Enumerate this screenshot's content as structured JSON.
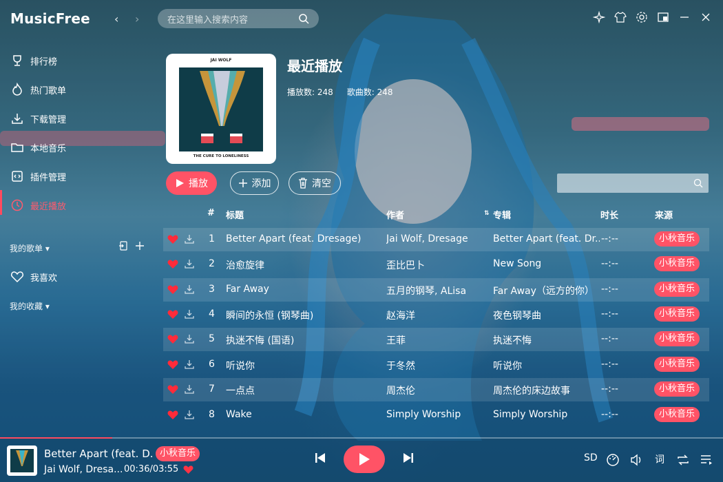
{
  "app": {
    "title": "MusicFree",
    "search_placeholder": "在这里输入搜索内容"
  },
  "titlebar": {
    "icons": [
      "sparkle-icon",
      "shirt-icon",
      "gear-icon",
      "minimode-icon",
      "minimize-icon",
      "close-icon"
    ]
  },
  "sidebar": {
    "items": [
      {
        "label": "排行榜",
        "icon": "trophy-icon"
      },
      {
        "label": "热门歌单",
        "icon": "fire-icon"
      },
      {
        "label": "下载管理",
        "icon": "download-icon"
      },
      {
        "label": "本地音乐",
        "icon": "folder-icon"
      },
      {
        "label": "插件管理",
        "icon": "plugin-icon"
      },
      {
        "label": "最近播放",
        "icon": "clock-icon",
        "active": true
      }
    ],
    "my_playlists_label": "我的歌单 ▾",
    "favorite_label": "我喜欢",
    "my_collection_label": "我的收藏 ▾"
  },
  "playlist": {
    "title": "最近播放",
    "play_count": "播放数: 248",
    "song_count": "歌曲数: 248",
    "cover_artist": "JAI WOLF",
    "cover_album": "THE CURE TO LONELINESS",
    "buttons": {
      "play": "播放",
      "add": "添加",
      "clear": "清空"
    }
  },
  "table": {
    "headers": {
      "index": "#",
      "title": "标题",
      "artist": "作者",
      "album": "专辑",
      "duration": "时长",
      "source": "来源"
    },
    "rows": [
      {
        "index": "1",
        "title": "Better Apart (feat. Dresage)",
        "artist": "Jai Wolf, Dresage",
        "album": "Better Apart (feat. Dr...",
        "duration": "--:--",
        "source": "小秋音乐"
      },
      {
        "index": "2",
        "title": "治愈旋律",
        "artist": "歪比巴卜",
        "album": "New Song",
        "duration": "--:--",
        "source": "小秋音乐"
      },
      {
        "index": "3",
        "title": "Far Away",
        "artist": "五月的钢琴, ALisa",
        "album": "Far Away（远方的你）",
        "duration": "--:--",
        "source": "小秋音乐"
      },
      {
        "index": "4",
        "title": "瞬间的永恒 (钢琴曲)",
        "artist": "赵海洋",
        "album": "夜色钢琴曲",
        "duration": "--:--",
        "source": "小秋音乐"
      },
      {
        "index": "5",
        "title": "执迷不悔 (国语)",
        "artist": "王菲",
        "album": "执迷不悔",
        "duration": "--:--",
        "source": "小秋音乐"
      },
      {
        "index": "6",
        "title": "听说你",
        "artist": "于冬然",
        "album": "听说你",
        "duration": "--:--",
        "source": "小秋音乐"
      },
      {
        "index": "7",
        "title": "一点点",
        "artist": "周杰伦",
        "album": "周杰伦的床边故事",
        "duration": "--:--",
        "source": "小秋音乐"
      },
      {
        "index": "8",
        "title": "Wake",
        "artist": "Simply Worship",
        "album": "Simply Worship",
        "duration": "--:--",
        "source": "小秋音乐"
      }
    ]
  },
  "player": {
    "title": "Better Apart (feat. D...",
    "source": "小秋音乐",
    "artist": "Jai Wolf, Dresa...",
    "time": "00:36/03:55",
    "progress": 0.155,
    "quality": "SD",
    "lyric_label": "词"
  },
  "colors": {
    "accent": "#ff5366"
  }
}
